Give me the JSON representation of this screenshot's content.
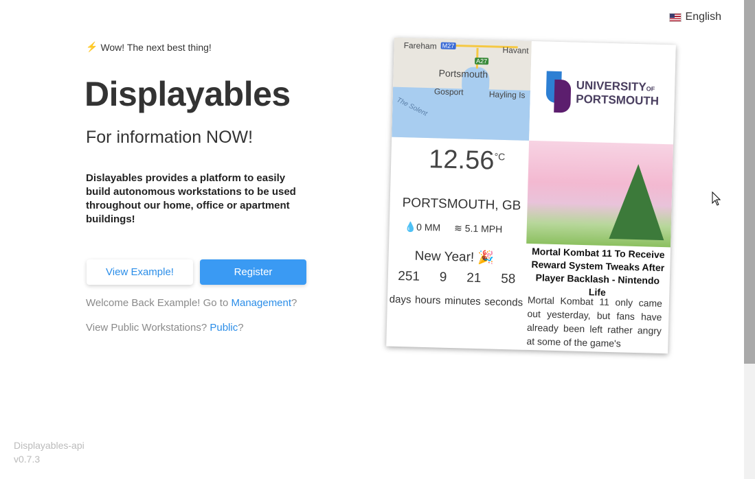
{
  "lang": {
    "label": "English",
    "flag_icon": "us-flag-icon"
  },
  "hero": {
    "tagline": "Wow! The next best thing!",
    "title": "Displayables",
    "subtitle": "For information NOW!",
    "description": "Dislayables provides a platform to easily build autonomous workstations to be used throughout our home, office or apartment buildings!"
  },
  "buttons": {
    "example": "View Example!",
    "register": "Register"
  },
  "links": {
    "welcome_prefix": "Welcome Back Example! Go to ",
    "management": "Management",
    "welcome_suffix": "?",
    "public_prefix": "View Public Workstations? ",
    "public": "Public",
    "public_suffix": "?"
  },
  "footer": {
    "name": "Displayables-api",
    "version": "v0.7.3"
  },
  "preview": {
    "map_labels": {
      "fareham": "Fareham",
      "m27": "M27",
      "havant": "Havant",
      "a27": "A27",
      "portsmouth": "Portsmouth",
      "gosport": "Gosport",
      "hayling": "Hayling Is",
      "solent": "The Solent"
    },
    "logo": {
      "line1": "UNIVERSITY",
      "of": "OF",
      "line2": "PORTSMOUTH"
    },
    "weather": {
      "temp": "12.56",
      "unit": "°C",
      "city": "PORTSMOUTH, GB",
      "rain": "0 MM",
      "wind": "5.1 MPH"
    },
    "countdown": {
      "event": "New Year!",
      "days": "251",
      "hours": "9",
      "minutes": "21",
      "seconds": "58",
      "days_label": "days",
      "hours_label": "hours",
      "minutes_label": "minutes",
      "seconds_label": "seconds"
    },
    "news": {
      "headline": "Mortal Kombat 11 To Receive Reward System Tweaks After Player Backlash - Nintendo Life",
      "body": "Mortal Kombat 11 only came out yesterday, but fans have already been left rather angry at some of the game's"
    }
  }
}
